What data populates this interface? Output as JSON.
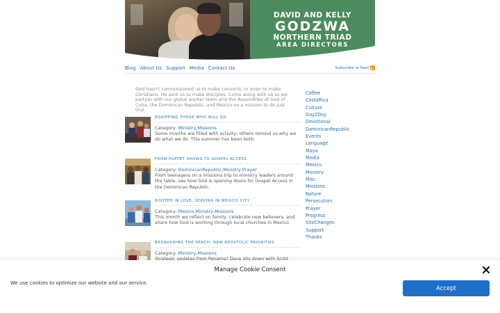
{
  "banner": {
    "line1": "DAVID AND KELLY",
    "line2": "GODZWA",
    "line3": "NORTHERN TRIAD",
    "line4": "AREA DIRECTORS"
  },
  "nav": {
    "items": [
      "Blog",
      "About Us",
      "Support",
      "Media",
      "Contact Us"
    ],
    "feed_label": "Subscribe to feed"
  },
  "intro": "God hasn't commissioned us to make converts, or even to make Christians. He sent us to make disciples. Come along with us as we partner with our global worker team and the Assemblies of God of Cuba, the Dominican Republic, and Mexico on a mission to do just that.",
  "posts": [
    {
      "title": "Equipping those who will go",
      "category_label": "Category:",
      "categories": "Ministry,Missions",
      "excerpt": "Some months are filled with activity; others remind us why we do what we do. This summer has been both."
    },
    {
      "title": "From Puppet Shows to Gospel Access",
      "category_label": "Category:",
      "categories": "DominicanRepublic,Ministry,Prayer",
      "excerpt": "From teenagers on a missions trip to ministry leaders around the table, see how God is opening doors for Gospel Access in the Dominican Republic."
    },
    {
      "title": "Rooted in Love, Serving in Mexico City",
      "category_label": "Category:",
      "categories": "Mexico,Ministry,Missions",
      "excerpt": "This month we reflect on family, celebrate new believers, and share how God is working through local churches in Mexico."
    },
    {
      "title": "Broadening the Reach: New Apostolic Priorities",
      "category_label": "Category:",
      "categories": "Ministry,Missions",
      "excerpt": "Strategic updates from Panama! Dave sits down with Scott Hanson to discuss Gospel Access and the 2033 goal. Watch or listen now."
    }
  ],
  "sidebar": {
    "categories": [
      "Coffee",
      "CostaRica",
      "Culture",
      "Day2Day",
      "Devotional",
      "DominicanRepublic",
      "Events",
      "Language",
      "Maya",
      "Media",
      "Mexico",
      "Ministry",
      "Misc",
      "Missions",
      "Nature",
      "Persecution",
      "Prayer",
      "Progress",
      "SiteChanges",
      "Support",
      "Thanks"
    ]
  },
  "cookie": {
    "title": "Manage Cookie Consent",
    "message": "We use cookies to optimize our website and our service.",
    "accept_label": "Accept"
  },
  "colors": {
    "brand_green": "#4b8b5d",
    "link_blue": "#2a6fa8",
    "accept_blue": "#1f6fc8",
    "rss_orange": "#f39a1e"
  }
}
